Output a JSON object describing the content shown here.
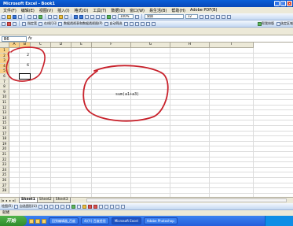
{
  "title": "Microsoft Excel - Book1",
  "menu": [
    "文件(F)",
    "编辑(E)",
    "视图(V)",
    "插入(I)",
    "格式(O)",
    "工具(T)",
    "数据(D)",
    "窗口(W)",
    "易生活(B)",
    "帮助(H)",
    "Adobe PDF(B)"
  ],
  "toolbar1": {
    "zoom": "100%",
    "font": "宋体",
    "size": "12"
  },
  "toolbar2": {
    "items": [
      "指定宽",
      "在线打印",
      "数据透视表和数据透视图(P)",
      "自动筛选"
    ],
    "right_items": [
      "帮我排版",
      "选定区域"
    ]
  },
  "formula_bar": {
    "name_box": "B6",
    "fx": "fx"
  },
  "grid": {
    "columns": [
      "A",
      "B",
      "C",
      "D",
      "E",
      "F",
      "G",
      "H",
      "I"
    ],
    "rows": [
      "1",
      "2",
      "3",
      "4",
      "5",
      "6",
      "7",
      "8",
      "9",
      "10",
      "11",
      "12",
      "13",
      "14",
      "15",
      "16",
      "17",
      "18",
      "19",
      "20",
      "21",
      "22",
      "23",
      "24",
      "25",
      "26",
      "27",
      "28"
    ],
    "cells": [
      {
        "ref": "B2",
        "value": "2"
      },
      {
        "ref": "B4",
        "value": "6"
      }
    ],
    "active_cell": "B6",
    "formula_annotation": "sum(a1+a3)"
  },
  "sheets": [
    "Sheet1",
    "Sheet2",
    "Sheet3"
  ],
  "active_sheet": "Sheet1",
  "drawbar": {
    "label": "绘图(R)",
    "autoshapes": "自选图形(U)"
  },
  "status": "就绪",
  "taskbar": {
    "start": "开始",
    "tasks": [
      "回到编辑器_百度",
      "4)(Y:) 百度经验",
      "Microsoft Excel",
      "Adobe Photoshop"
    ],
    "active_task": 2
  },
  "annotation_color": "#c8202a"
}
